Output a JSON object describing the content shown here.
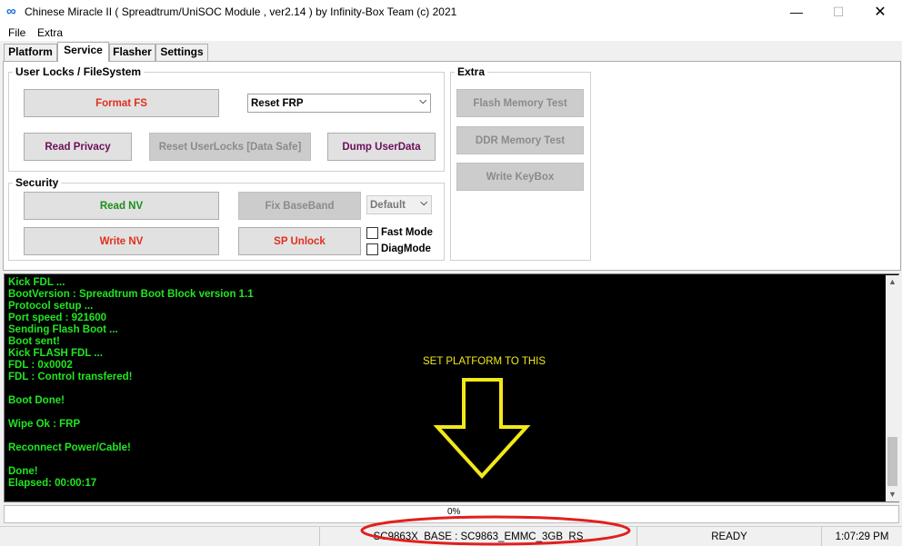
{
  "window": {
    "title": "Chinese Miracle II ( Spreadtrum/UniSOC Module , ver2.14 ) by Infinity-Box Team (c) 2021",
    "app_icon": "∞",
    "minimize": "—",
    "maximize": "☐",
    "close": "✕"
  },
  "menu": {
    "items": [
      "File",
      "Extra"
    ]
  },
  "tabs": [
    "Platform",
    "Service",
    "Flasher",
    "Settings"
  ],
  "active_tab": "Service",
  "userlocks": {
    "title": "User Locks  / FileSystem",
    "format_fs": "Format FS",
    "reset_select": "Reset FRP",
    "read_privacy": "Read Privacy",
    "reset_userlocks": "Reset UserLocks [Data Safe]",
    "dump_userdata": "Dump UserData"
  },
  "security": {
    "title": "Security",
    "read_nv": "Read NV",
    "fix_baseband": "Fix BaseBand",
    "baseband_select": "Default",
    "write_nv": "Write NV",
    "sp_unlock": "SP Unlock",
    "fast_mode": "Fast Mode",
    "diag_mode": "DiagMode"
  },
  "extra": {
    "title": "Extra",
    "flash_memory_test": "Flash Memory Test",
    "ddr_memory_test": "DDR Memory Test",
    "write_keybox": "Write KeyBox"
  },
  "log": {
    "lines": [
      "Kick FDL ...",
      "BootVersion : Spreadtrum Boot Block version 1.1",
      "Protocol setup ...",
      "Port speed : 921600",
      "Sending Flash Boot ...",
      "Boot sent!",
      "Kick FLASH FDL ...",
      "FDL : 0x0002",
      "FDL : Control transfered!",
      "",
      "Boot Done!",
      "",
      "Wipe Ok : FRP",
      "",
      "Reconnect Power/Cable!",
      "",
      "Done!",
      "Elapsed: 00:00:17"
    ],
    "color": "#21e621"
  },
  "annotation": {
    "text": "SET PLATFORM TO THIS",
    "arrow_color": "#f2e81a",
    "ellipse_color": "#e0201e"
  },
  "progress": {
    "text": "0%",
    "value": 0
  },
  "status": {
    "platform": "SC9863X_BASE : SC9863_EMMC_3GB_RS",
    "state": "READY",
    "time": "1:07:29 PM"
  }
}
